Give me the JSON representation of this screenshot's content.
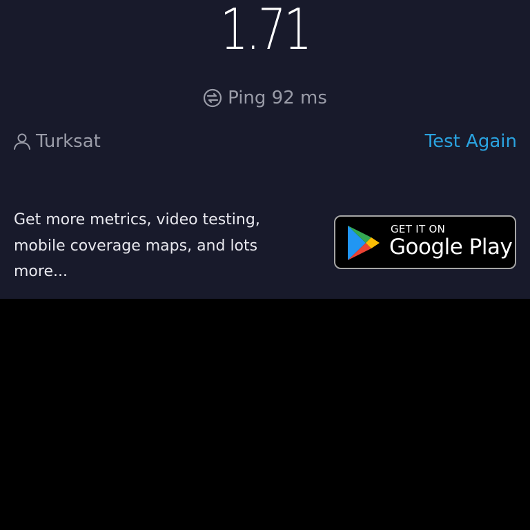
{
  "result": {
    "speed_value": "1.71"
  },
  "ping": {
    "icon": "ping-icon",
    "text": "Ping 92 ms"
  },
  "provider": {
    "icon": "user-icon",
    "name": "Turksat"
  },
  "actions": {
    "test_again_label": "Test Again"
  },
  "promo": {
    "text": "Get more metrics, video testing, mobile coverage maps, and lots more..."
  },
  "google_play_badge": {
    "small_text": "GET IT ON",
    "big_text": "Google Play",
    "icon": "google-play-icon"
  },
  "colors": {
    "panel_background": "#181a2b",
    "lower_background": "#000000",
    "accent": "#2aa3e0",
    "muted_text": "#9a9ca8",
    "primary_text": "#ffffff"
  }
}
